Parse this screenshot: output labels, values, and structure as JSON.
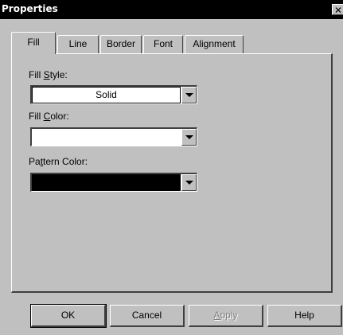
{
  "window": {
    "title": "Properties",
    "close_label": "✕"
  },
  "tabs": [
    {
      "label": "Fill",
      "active": true
    },
    {
      "label": "Line",
      "active": false
    },
    {
      "label": "Border",
      "active": false
    },
    {
      "label": "Font",
      "active": false
    },
    {
      "label": "Alignment",
      "active": false
    }
  ],
  "fill_style": {
    "label_pre": "Fill ",
    "label_accel": "S",
    "label_post": "tyle:",
    "value": "Solid"
  },
  "fill_color": {
    "label_pre": "Fill ",
    "label_accel": "C",
    "label_post": "olor:",
    "value": "",
    "swatch": "#ffffff"
  },
  "pattern_color": {
    "label_pre": "Pa",
    "label_accel": "t",
    "label_post": "tern Color:",
    "value": "",
    "swatch": "#000000"
  },
  "buttons": {
    "ok": "OK",
    "cancel": "Cancel",
    "apply_pre": "",
    "apply_accel": "A",
    "apply_post": "pply",
    "help": "Help"
  }
}
